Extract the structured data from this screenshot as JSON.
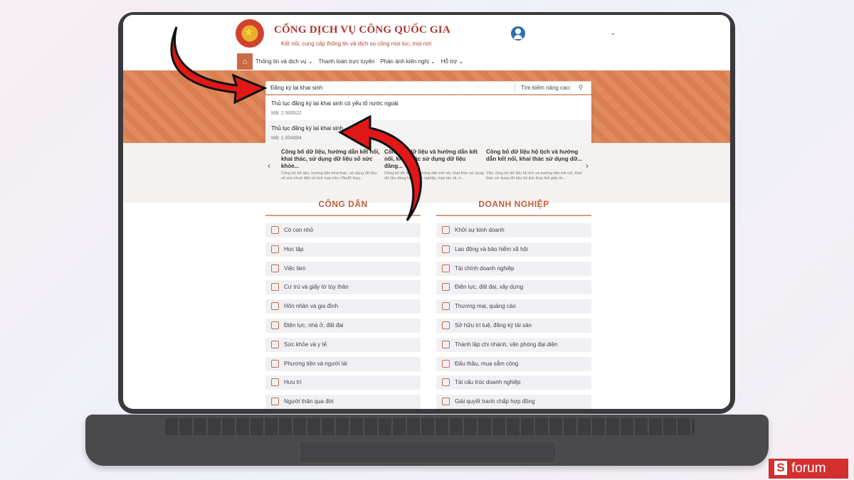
{
  "header": {
    "title": "CỔNG DỊCH VỤ CÔNG QUỐC GIA",
    "subtitle": "Kết nối, cung cấp thông tin và dịch vụ công mọi lúc, mọi nơi"
  },
  "nav": {
    "items": [
      "Thông tin và dịch vụ",
      "Thanh toán trực tuyến",
      "Phản ánh kiến nghị",
      "Hỗ trợ"
    ]
  },
  "search": {
    "value": "Đăng ký lại khai sinh",
    "advanced_label": "Tìm kiếm nâng cao",
    "results": [
      {
        "title": "Thủ tục đăng ký lại khai sinh có yếu tố nước ngoài",
        "code": "Mã: 2.000522"
      },
      {
        "title": "Thủ tục đăng ký lại khai sinh",
        "code": "Mã: 1.004884"
      }
    ]
  },
  "news": [
    {
      "title": "Công bố dữ liệu, hướng dẫn kết nối, khai thác, sử dụng dữ liệu sổ sức khỏe...",
      "desc": "Công bố dữ liệu, hướng dẫn khai thác, sử dụng dữ liệu sổ sức khoẻ điện tử tích hợp trên VNeID thay..."
    },
    {
      "title": "Công bố dữ liệu và hướng dẫn kết nối, khai thác sử dụng dữ liệu đăng...",
      "desc": "Công bố dữ liệu và hướng dẫn kết nối, khai thác sử dụng dữ liệu đăng ký doanh nghiệp, hợp tác xã, h..."
    },
    {
      "title": "Công bố dữ liệu hộ tịch và hướng dẫn kết nối, khai thác sử dụng dữ...",
      "desc": "Việc công bố dữ liệu hộ tịch và hướng dẫn kết nối, khai thác sử dụng dữ liệu hộ tịch thay thế giấy tờ..."
    }
  ],
  "citizen": {
    "heading": "CÔNG DÂN",
    "items": [
      "Có con nhỏ",
      "Học tập",
      "Việc làm",
      "Cư trú và giấy tờ tùy thân",
      "Hôn nhân và gia đình",
      "Điện lực, nhà ở, đất đai",
      "Sức khỏe và y tế",
      "Phương tiện và người lái",
      "Hưu trí",
      "Người thân qua đời"
    ]
  },
  "business": {
    "heading": "DOANH NGHIỆP",
    "items": [
      "Khởi sự kinh doanh",
      "Lao động và bảo hiểm xã hội",
      "Tài chính doanh nghiệp",
      "Điện lực, đất đai, xây dựng",
      "Thương mại, quảng cáo",
      "Sở hữu trí tuệ, đăng ký tài sản",
      "Thành lập chi nhánh, văn phòng đại diện",
      "Đấu thầu, mua sắm công",
      "Tái cấu trúc doanh nghiệp",
      "Giải quyết tranh chấp hợp đồng"
    ]
  },
  "brand": {
    "letter": "S",
    "name": "forum"
  },
  "colors": {
    "accent": "#c25c3a",
    "banner": "#e08a5d",
    "arrow": "#e01818"
  }
}
